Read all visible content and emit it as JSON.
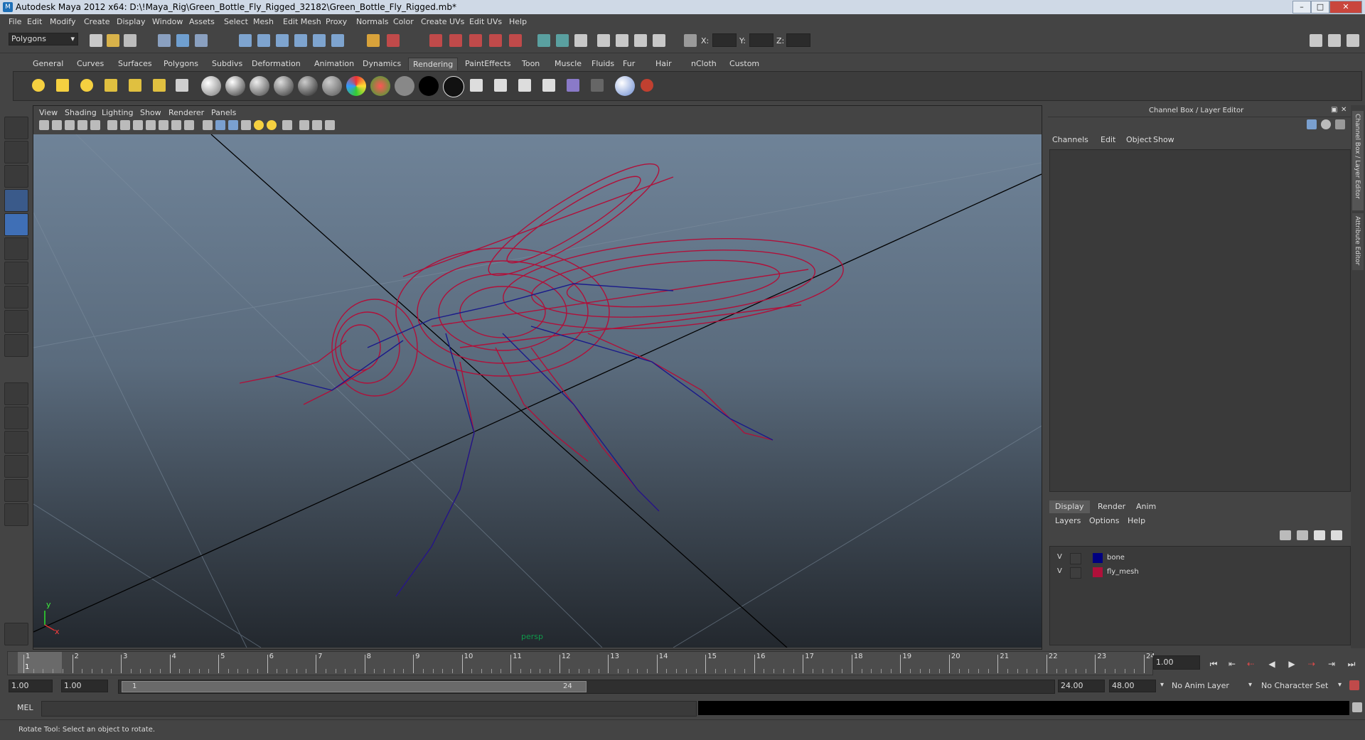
{
  "window": {
    "title": "Autodesk Maya 2012 x64: D:\\!Maya_Rig\\Green_Bottle_Fly_Rigged_32182\\Green_Bottle_Fly_Rigged.mb*",
    "app_icon": "M",
    "controls": [
      "minimize-icon",
      "maximize-icon",
      "close-icon"
    ]
  },
  "menubar": [
    "File",
    "Edit",
    "Modify",
    "Create",
    "Display",
    "Window",
    "Assets",
    "Select",
    "Mesh",
    "Edit Mesh",
    "Proxy",
    "Normals",
    "Color",
    "Create UVs",
    "Edit UVs",
    "Help"
  ],
  "statusline": {
    "mode": "Polygons",
    "x_label": "X:",
    "y_label": "Y:",
    "z_label": "Z:"
  },
  "shelf": {
    "tabs": [
      "General",
      "Curves",
      "Surfaces",
      "Polygons",
      "Subdivs",
      "Deformation",
      "Animation",
      "Dynamics",
      "Rendering",
      "PaintEffects",
      "Toon",
      "Muscle",
      "Fluids",
      "Fur",
      "Hair",
      "nCloth",
      "Custom"
    ],
    "active_tab": "Rendering"
  },
  "viewport": {
    "menus": [
      "View",
      "Shading",
      "Lighting",
      "Show",
      "Renderer",
      "Panels"
    ],
    "camera_label": "persp",
    "axis_y": "y",
    "axis_x": "x"
  },
  "channel_box": {
    "title": "Channel Box / Layer Editor",
    "menus": [
      "Channels",
      "Edit",
      "Object",
      "Show"
    ],
    "side_tabs": [
      "Channel Box / Layer Editor",
      "Attribute Editor"
    ]
  },
  "layer_editor": {
    "tabs": [
      "Display",
      "Render",
      "Anim"
    ],
    "active_tab": "Display",
    "menus": [
      "Layers",
      "Options",
      "Help"
    ],
    "layers": [
      {
        "visible": "V",
        "name": "bone",
        "color": "#000080"
      },
      {
        "visible": "V",
        "name": "fly_mesh",
        "color": "#b0103a"
      }
    ]
  },
  "timeline": {
    "start": 1,
    "end": 24,
    "current_frame": "1",
    "current_time_field": "1.00"
  },
  "range": {
    "start_time": "1.00",
    "playback_start": "1.00",
    "slider_start": "1",
    "slider_end": "24",
    "playback_end": "24.00",
    "end_time": "48.00",
    "anim_layer": "No Anim Layer",
    "character_set": "No Character Set"
  },
  "command_line": {
    "label": "MEL"
  },
  "help_line": {
    "text": "Rotate Tool: Select an object to rotate."
  },
  "colors": {
    "wire": "#b0103a",
    "bone": "#1a1a8a"
  }
}
